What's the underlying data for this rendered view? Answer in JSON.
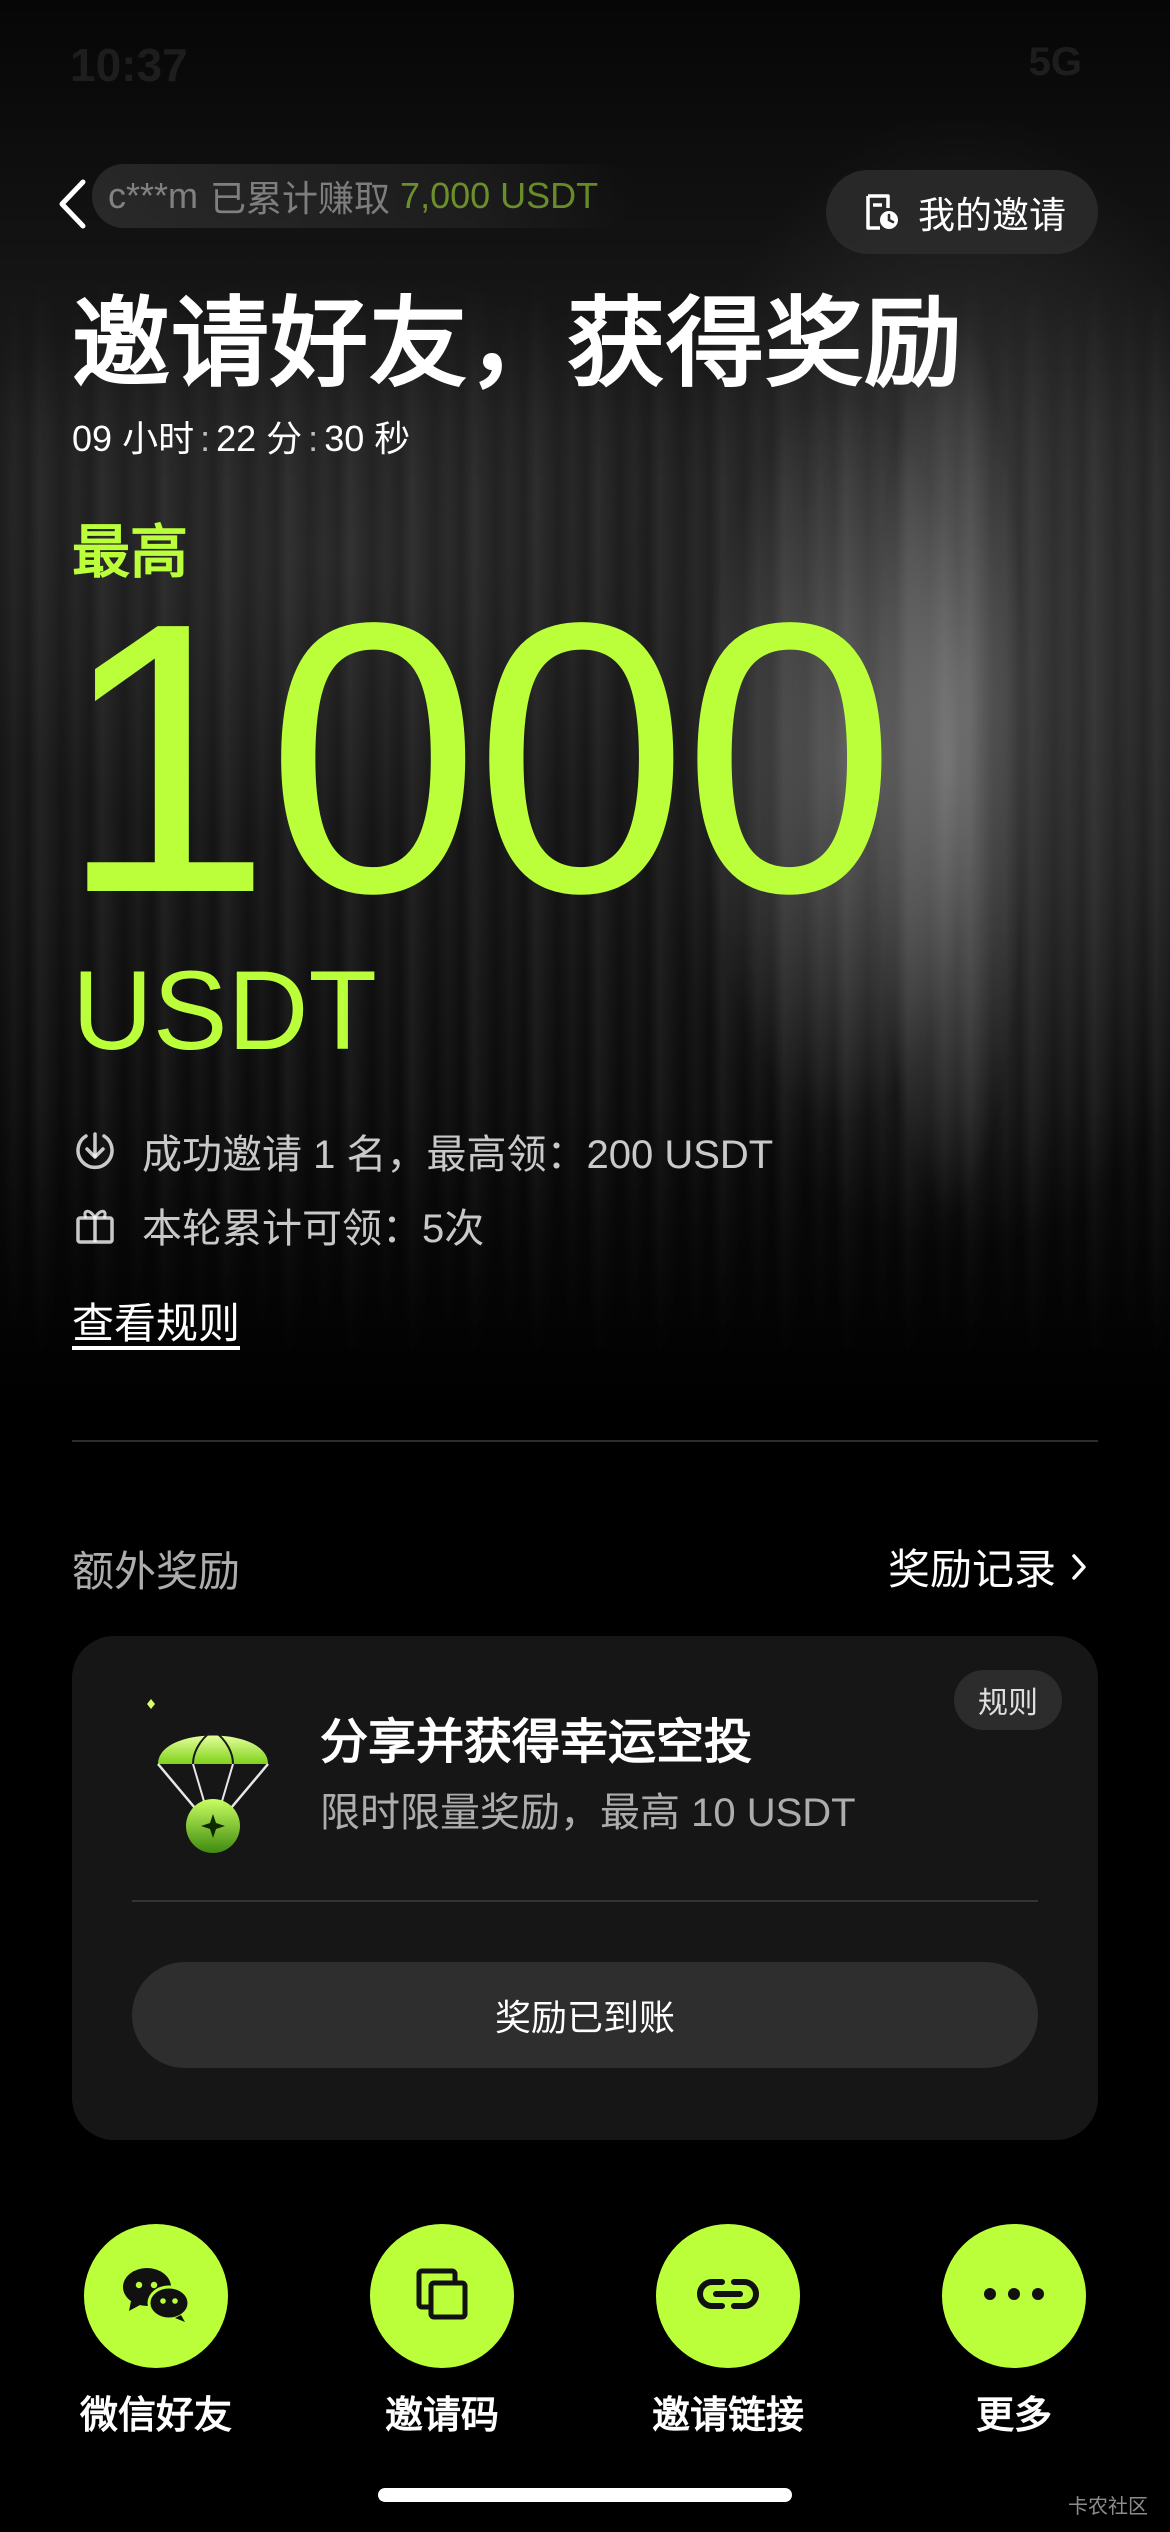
{
  "colors": {
    "accent": "#bbff3a",
    "background": "#000000",
    "card": "#161616"
  },
  "status_bar": {
    "time": "10:37",
    "right": "5G"
  },
  "nav": {
    "back_icon": "chevron-left-icon",
    "ticker_user": "c***m",
    "ticker_text": "已累计赚取",
    "ticker_amount": "7,000 USDT",
    "my_invites_label": "我的邀请",
    "my_invites_icon": "document-clock-icon"
  },
  "hero": {
    "title": "邀请好友，获得奖励",
    "countdown": {
      "hours": "09",
      "hours_unit": "小时",
      "minutes": "22",
      "minutes_unit": "分",
      "seconds": "30",
      "seconds_unit": "秒",
      "separator": ":"
    },
    "max_label": "最高",
    "max_amount": "1000",
    "max_unit": "USDT",
    "info_rows": [
      {
        "icon": "download-circle-icon",
        "text": "成功邀请 1 名，最高领：200 USDT"
      },
      {
        "icon": "gift-icon",
        "text": "本轮累计可领：5次"
      }
    ],
    "rules_link": "查看规则"
  },
  "extra": {
    "section_title": "额外奖励",
    "records_link": "奖励记录",
    "card": {
      "icon": "parachute-airdrop-icon",
      "title": "分享并获得幸运空投",
      "subtitle": "限时限量奖励，最高 10 USDT",
      "rule_badge": "规则",
      "button_label": "奖励已到账"
    }
  },
  "share": [
    {
      "icon": "wechat-icon",
      "label": "微信好友"
    },
    {
      "icon": "copy-icon",
      "label": "邀请码"
    },
    {
      "icon": "link-icon",
      "label": "邀请链接"
    },
    {
      "icon": "more-dots-icon",
      "label": "更多"
    }
  ],
  "watermark": "卡农社区"
}
